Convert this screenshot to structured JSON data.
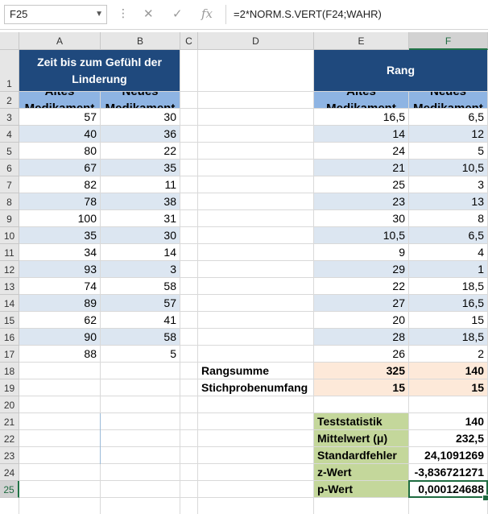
{
  "toolbar": {
    "name_box": "F25",
    "formula": "=2*NORM.S.VERT(F24;WAHR)",
    "cancel_icon": "✕",
    "confirm_icon": "✓",
    "fx_icon": "fx"
  },
  "columns": [
    "A",
    "B",
    "C",
    "D",
    "E",
    "F"
  ],
  "rows": [
    "1",
    "2",
    "3",
    "4",
    "5",
    "6",
    "7",
    "8",
    "9",
    "10",
    "11",
    "12",
    "13",
    "14",
    "15",
    "16",
    "17",
    "18",
    "19",
    "20",
    "21",
    "22",
    "23",
    "24",
    "25"
  ],
  "table_left": {
    "title": "Zeit bis zum Gefühl der Linderung",
    "col1_header": "Altes Medikament",
    "col2_header": "Neues Medikament",
    "col1": [
      "57",
      "40",
      "80",
      "67",
      "82",
      "78",
      "100",
      "35",
      "34",
      "93",
      "74",
      "89",
      "62",
      "90",
      "88"
    ],
    "col2": [
      "30",
      "36",
      "22",
      "35",
      "11",
      "38",
      "31",
      "30",
      "14",
      "3",
      "58",
      "57",
      "41",
      "58",
      "5"
    ]
  },
  "table_right": {
    "title": "Rang",
    "col1_header": "Altes Medikament",
    "col2_header": "Neues Medikament",
    "col1": [
      "16,5",
      "14",
      "24",
      "21",
      "25",
      "23",
      "30",
      "10,5",
      "9",
      "29",
      "22",
      "27",
      "20",
      "28",
      "26"
    ],
    "col2": [
      "6,5",
      "12",
      "5",
      "10,5",
      "3",
      "13",
      "8",
      "6,5",
      "4",
      "1",
      "18,5",
      "16,5",
      "15",
      "18,5",
      "2"
    ]
  },
  "summary": {
    "rangsumme_label": "Rangsumme",
    "rangsumme_e": "325",
    "rangsumme_f": "140",
    "stichprobe_label": "Stichprobenumfang",
    "stichprobe_e": "15",
    "stichprobe_f": "15"
  },
  "stats": {
    "teststatistik_label": "Teststatistik",
    "teststatistik": "140",
    "mittelwert_label": "Mittelwert (μ)",
    "mittelwert": "232,5",
    "standardfehler_label": "Standardfehler",
    "standardfehler": "24,1091269",
    "zwert_label": "z-Wert",
    "zwert": "-3,836721271",
    "pwert_label": "p-Wert",
    "pwert": "0,000124688"
  },
  "colors": {
    "header_dark": "#1f497d",
    "header_light": "#8eb4e3",
    "band": "#dce6f1",
    "peach": "#fde9d9",
    "green": "#c4d79b",
    "excel_green": "#1e6b40"
  }
}
